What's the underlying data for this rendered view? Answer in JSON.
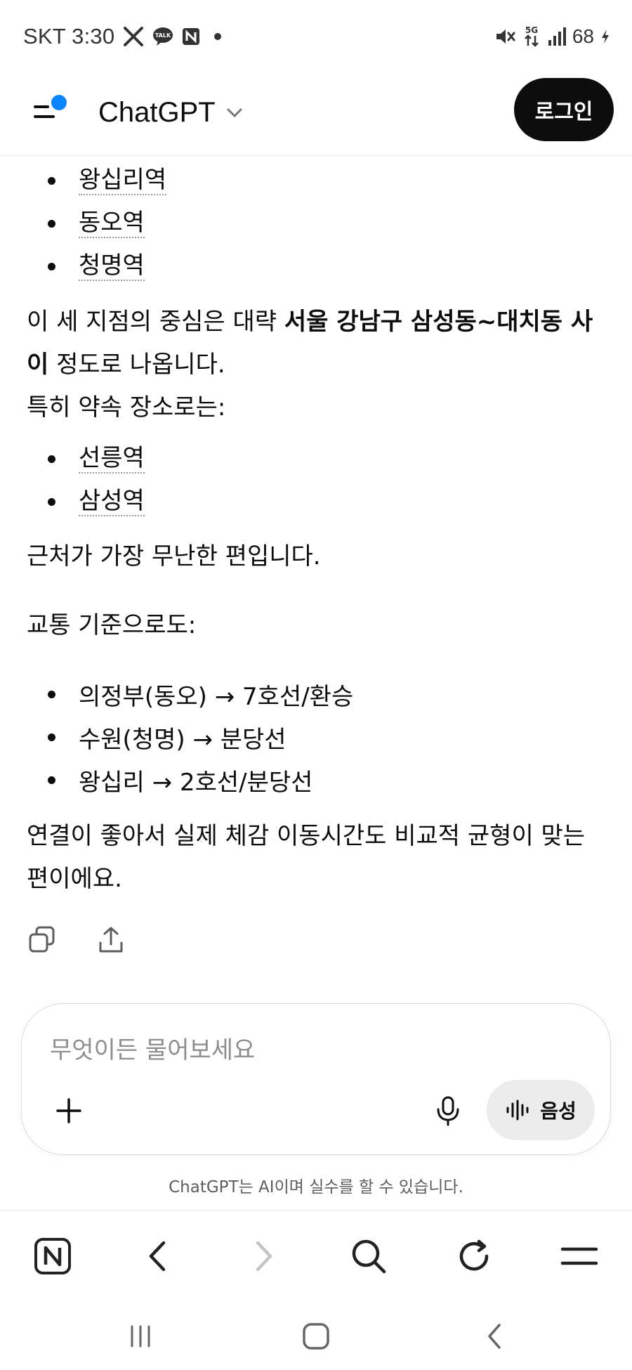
{
  "status_bar": {
    "carrier_time": "SKT 3:30",
    "battery": "68",
    "icons": [
      "x-icon",
      "kakaotalk-icon",
      "naver-icon",
      "notification-dot",
      "mute-icon",
      "5g-icon",
      "signal-icon",
      "charging-icon"
    ]
  },
  "header": {
    "title": "ChatGPT",
    "login_label": "로그인",
    "accent_color": "#0a84ff"
  },
  "message": {
    "list1": [
      "왕십리역",
      "동오역",
      "청명역"
    ],
    "para1_pre": "이 세 지점의 중심은 대략 ",
    "para1_bold_a": "서울 강남구 삼성동~대치동 사",
    "para1_bold_b": "이",
    "para1_post": " 정도로 나옵니다.",
    "para2": "특히 약속 장소로는:",
    "list2": [
      "선릉역",
      "삼성역"
    ],
    "para3": "근처가 가장 무난한 편입니다.",
    "para4": "교통 기준으로도:",
    "list3": [
      "의정부(동오) → 7호선/환승",
      "수원(청명) → 분당선",
      "왕십리 → 2호선/분당선"
    ],
    "para5_line1": "연결이 좋아서 실제 체감 이동시간도 비교적 균형이 맞는",
    "para5_line2": "편이에요."
  },
  "composer": {
    "placeholder": "무엇이든 물어보세요",
    "voice_label": "음성"
  },
  "disclaimer": "ChatGPT는 AI이며 실수를 할 수 있습니다.",
  "browser_bar": {
    "items": [
      "naver-home-icon",
      "back-icon",
      "forward-icon",
      "search-icon",
      "reload-icon",
      "menu-icon"
    ]
  },
  "system_nav": {
    "items": [
      "recent-apps-icon",
      "home-icon",
      "back-icon"
    ]
  }
}
